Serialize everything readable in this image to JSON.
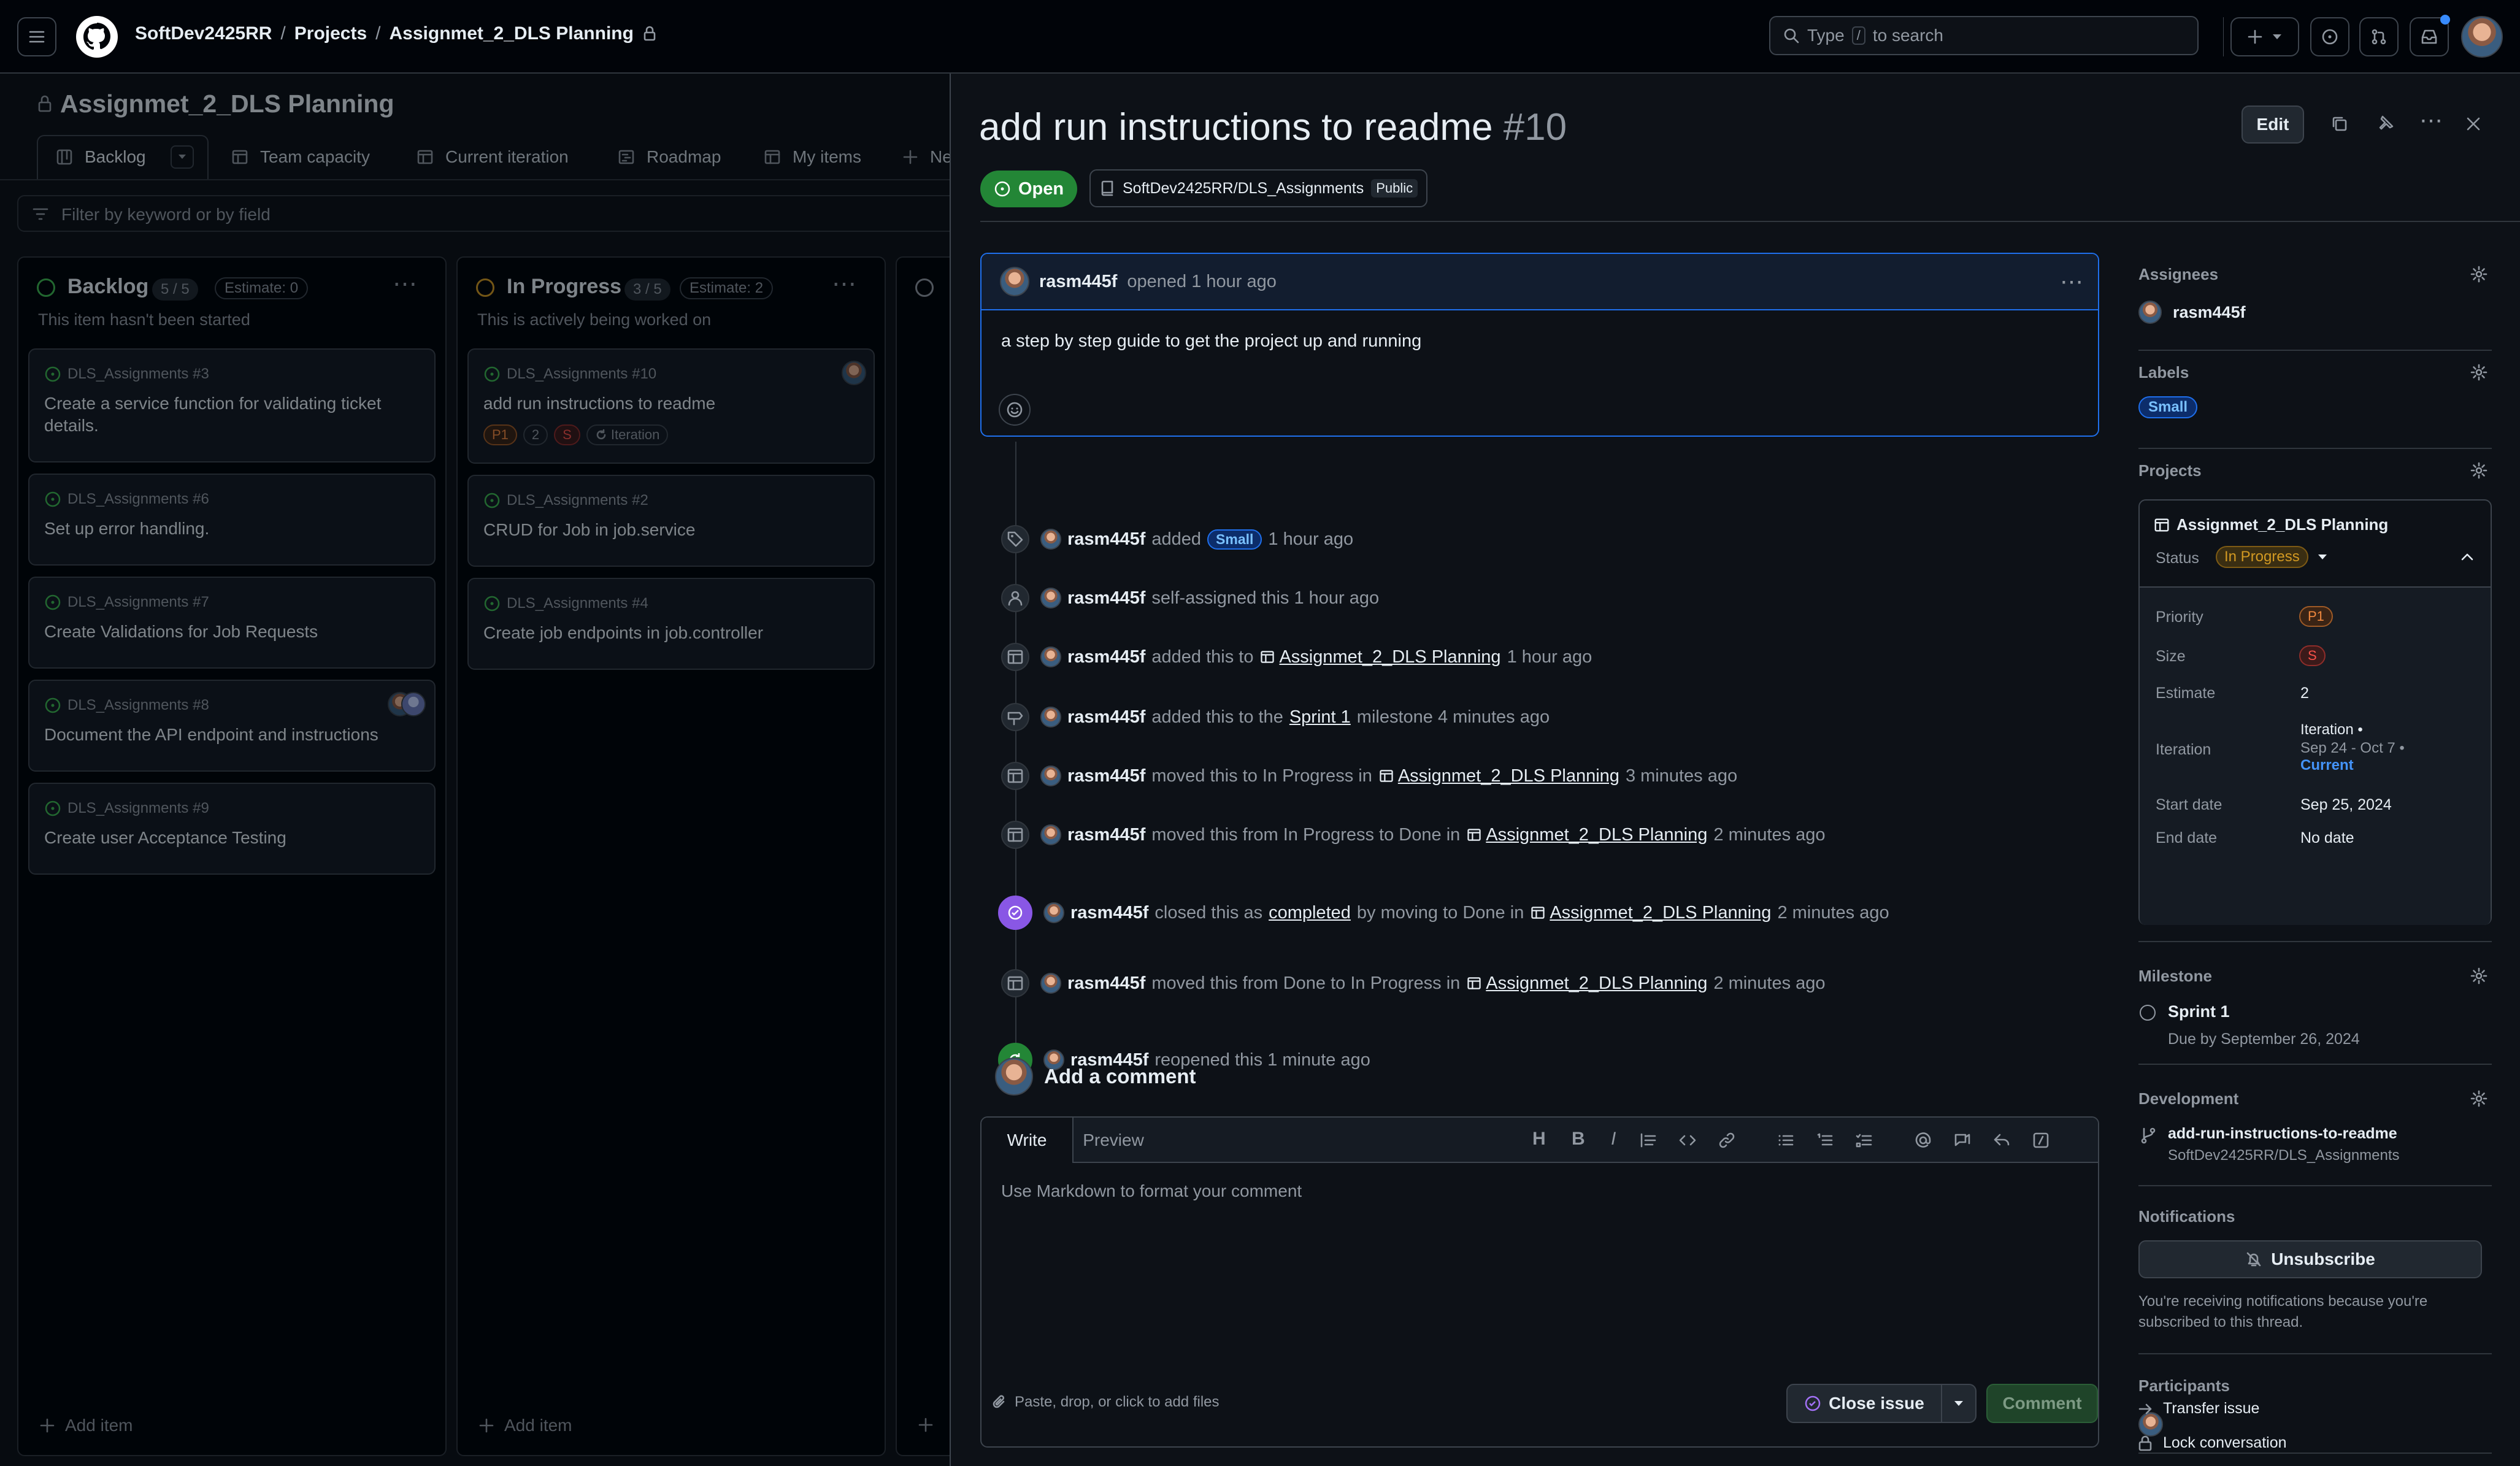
{
  "header": {
    "owner": "SoftDev2425RR",
    "projects": "Projects",
    "project": "Assignmet_2_DLS Planning",
    "search_prefix": "Type",
    "search_key": "/",
    "search_suffix": "to search"
  },
  "project": {
    "title": "Assignmet_2_DLS Planning",
    "tabs": [
      {
        "label": "Backlog",
        "icon": "board-icon"
      },
      {
        "label": "Team capacity",
        "icon": "table-icon"
      },
      {
        "label": "Current iteration",
        "icon": "table-icon"
      },
      {
        "label": "Roadmap",
        "icon": "roadmap-icon"
      },
      {
        "label": "My items",
        "icon": "table-icon"
      },
      {
        "label": "Ne",
        "icon": "plus-icon"
      }
    ],
    "filter_placeholder": "Filter by keyword or by field",
    "columns": [
      {
        "title": "Backlog",
        "count": "5 / 5",
        "estimate": "Estimate: 0",
        "desc": "This item hasn't been started",
        "status_color": "#3fb950",
        "add": "Add item",
        "cards": [
          {
            "repo": "DLS_Assignments #3",
            "title": "Create a service function for validating ticket details."
          },
          {
            "repo": "DLS_Assignments #6",
            "title": "Set up error handling."
          },
          {
            "repo": "DLS_Assignments #7",
            "title": "Create Validations for Job Requests"
          },
          {
            "repo": "DLS_Assignments #8",
            "title": "Document the API endpoint and instructions"
          },
          {
            "repo": "DLS_Assignments #9",
            "title": "Create user Acceptance Testing"
          }
        ]
      },
      {
        "title": "In Progress",
        "count": "3 / 5",
        "estimate": "Estimate: 2",
        "desc": "This is actively being worked on",
        "status_color": "#d29922",
        "add": "Add item",
        "cards": [
          {
            "repo": "DLS_Assignments #10",
            "title": "add run instructions to readme",
            "tags": [
              "P1",
              "2",
              "S",
              "Iteration"
            ]
          },
          {
            "repo": "DLS_Assignments #2",
            "title": "CRUD for Job in job.service"
          },
          {
            "repo": "DLS_Assignments #4",
            "title": "Create job endpoints in job.controller"
          }
        ]
      }
    ]
  },
  "issue": {
    "title": "add run instructions to readme",
    "number": "#10",
    "state": "Open",
    "repo": "SoftDev2425RR/DLS_Assignments",
    "visibility": "Public",
    "edit": "Edit",
    "comment": {
      "author": "rasm445f",
      "meta": "opened 1 hour ago",
      "body": "a step by step guide to get the project up and running"
    },
    "timeline": [
      {
        "icon": "tag-icon",
        "parts": [
          [
            "b",
            "rasm445f"
          ],
          [
            "t",
            "added"
          ],
          [
            "badge",
            "Small"
          ],
          [
            "t",
            "1 hour ago"
          ]
        ]
      },
      {
        "icon": "person-icon",
        "parts": [
          [
            "b",
            "rasm445f"
          ],
          [
            "t",
            "self-assigned this 1 hour ago"
          ]
        ]
      },
      {
        "icon": "table-icon",
        "parts": [
          [
            "b",
            "rasm445f"
          ],
          [
            "t",
            "added this to"
          ],
          [
            "proj",
            "Assignmet_2_DLS Planning"
          ],
          [
            "t",
            "1 hour ago"
          ]
        ]
      },
      {
        "icon": "milestone-icon",
        "parts": [
          [
            "b",
            "rasm445f"
          ],
          [
            "t",
            "added this to the"
          ],
          [
            "u",
            "Sprint 1"
          ],
          [
            "t",
            "milestone 4 minutes ago"
          ]
        ]
      },
      {
        "icon": "table-icon",
        "parts": [
          [
            "b",
            "rasm445f"
          ],
          [
            "t",
            "moved this to In Progress in"
          ],
          [
            "proj",
            "Assignmet_2_DLS Planning"
          ],
          [
            "t",
            "3 minutes ago"
          ]
        ]
      },
      {
        "icon": "table-icon",
        "parts": [
          [
            "b",
            "rasm445f"
          ],
          [
            "t",
            "moved this from In Progress to Done in"
          ],
          [
            "proj",
            "Assignmet_2_DLS Planning"
          ],
          [
            "t",
            "2 minutes ago"
          ]
        ]
      },
      {
        "icon": "check-circle-icon",
        "color": "#8957e5",
        "parts": [
          [
            "b",
            "rasm445f"
          ],
          [
            "t",
            "closed this as"
          ],
          [
            "u",
            "completed"
          ],
          [
            "t",
            "by moving to Done in"
          ],
          [
            "proj",
            "Assignmet_2_DLS Planning"
          ],
          [
            "t",
            "2 minutes ago"
          ]
        ]
      },
      {
        "icon": "table-icon",
        "parts": [
          [
            "b",
            "rasm445f"
          ],
          [
            "t",
            "moved this from Done to In Progress in"
          ],
          [
            "proj",
            "Assignmet_2_DLS Planning"
          ],
          [
            "t",
            "2 minutes ago"
          ]
        ]
      },
      {
        "icon": "reopen-icon",
        "color": "#238636",
        "parts": [
          [
            "b",
            "rasm445f"
          ],
          [
            "t",
            "reopened this 1 minute ago"
          ]
        ]
      }
    ],
    "add_comment": "Add a comment",
    "write": "Write",
    "preview": "Preview",
    "placeholder": "Use Markdown to format your comment",
    "attach": "Paste, drop, or click to add files",
    "close_issue": "Close issue",
    "comment_btn": "Comment"
  },
  "sidebar": {
    "assignees_h": "Assignees",
    "assignee": "rasm445f",
    "labels_h": "Labels",
    "label": "Small",
    "projects_h": "Projects",
    "project_name": "Assignmet_2_DLS Planning",
    "status_label": "Status",
    "status": "In Progress",
    "fields": [
      {
        "k": "Priority",
        "v": "P1"
      },
      {
        "k": "Size",
        "v": "S"
      },
      {
        "k": "Estimate",
        "v": "2"
      },
      {
        "k": "Iteration",
        "v": "Iteration •",
        "v2": "Sep 24 - Oct 7 •",
        "v3": "Current"
      },
      {
        "k": "Start date",
        "v": "Sep 25, 2024"
      },
      {
        "k": "End date",
        "v": "No date"
      }
    ],
    "milestone_h": "Milestone",
    "milestone": "Sprint 1",
    "milestone_due": "Due by September 26, 2024",
    "dev_h": "Development",
    "branch": "add-run-instructions-to-readme",
    "branch_repo": "SoftDev2425RR/DLS_Assignments",
    "notif_h": "Notifications",
    "unsubscribe": "Unsubscribe",
    "notif_text1": "You're receiving notifications because you're",
    "notif_text2": "subscribed to this thread.",
    "participants_h": "Participants",
    "transfer": "Transfer issue",
    "lock": "Lock conversation"
  },
  "colors": {
    "accent_green": "#238636",
    "open_green": "#3fb950",
    "purple": "#8957e5",
    "label_blue": "#388bfd",
    "p1": "#f0883e",
    "size_s": "#f85149"
  }
}
